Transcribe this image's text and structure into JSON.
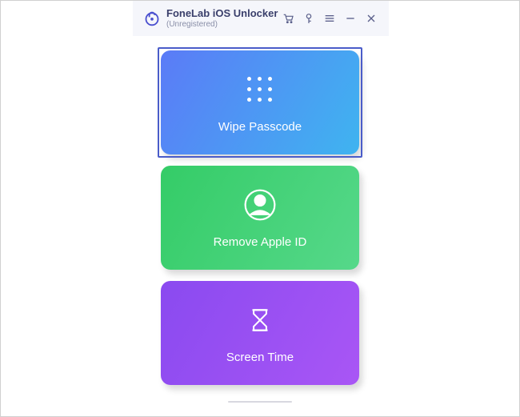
{
  "header": {
    "app_title": "FoneLab iOS Unlocker",
    "app_subtitle": "(Unregistered)"
  },
  "cards": {
    "wipe": {
      "label": "Wipe Passcode"
    },
    "remove": {
      "label": "Remove Apple ID"
    },
    "screentime": {
      "label": "Screen Time"
    }
  }
}
